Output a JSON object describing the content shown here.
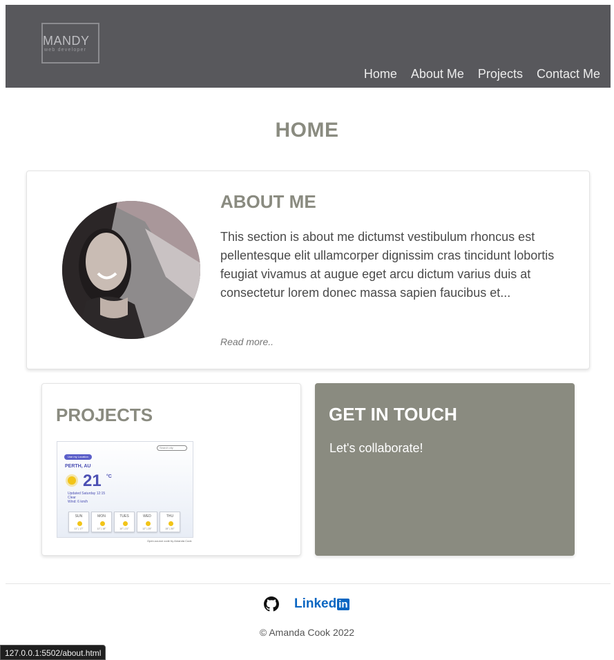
{
  "header": {
    "logo_name": "MANDY",
    "logo_sub": "web developer",
    "nav": [
      "Home",
      "About Me",
      "Projects",
      "Contact Me"
    ]
  },
  "page": {
    "title": "HOME"
  },
  "about": {
    "title": "ABOUT ME",
    "text": "This section is about me dictumst vestibulum rhoncus est pellentesque elit ullamcorper dignissim cras tincidunt lobortis feugiat vivamus at augue eget arcu dictum varius duis at consectetur lorem donec massa sapien faucibus et...",
    "read_more": "Read more.."
  },
  "projects": {
    "title": "PROJECTS",
    "shot": {
      "pill": "Use my Location",
      "search": "Search city",
      "city": "PERTH, AU",
      "temp": "21",
      "unit": "°C",
      "details": "Updated Saturday 12:15\nClear\nWind: 6 km/h",
      "days": [
        {
          "name": "SUN",
          "temps": "11° | 17°"
        },
        {
          "name": "MON",
          "temps": "11° | 18°"
        },
        {
          "name": "TUES",
          "temps": "10° | 21°"
        },
        {
          "name": "WED",
          "temps": "12° | 25°"
        },
        {
          "name": "THU",
          "temps": "15° | 30°"
        }
      ],
      "caption": "Open-source code by Amanda Cook"
    }
  },
  "touch": {
    "title": "GET IN TOUCH",
    "text": "Let's collaborate!"
  },
  "footer": {
    "copyright": "© Amanda Cook 2022",
    "linkedin": "Linked",
    "linkedin_box": "in"
  },
  "status": {
    "url": "127.0.0.1:5502/about.html"
  }
}
